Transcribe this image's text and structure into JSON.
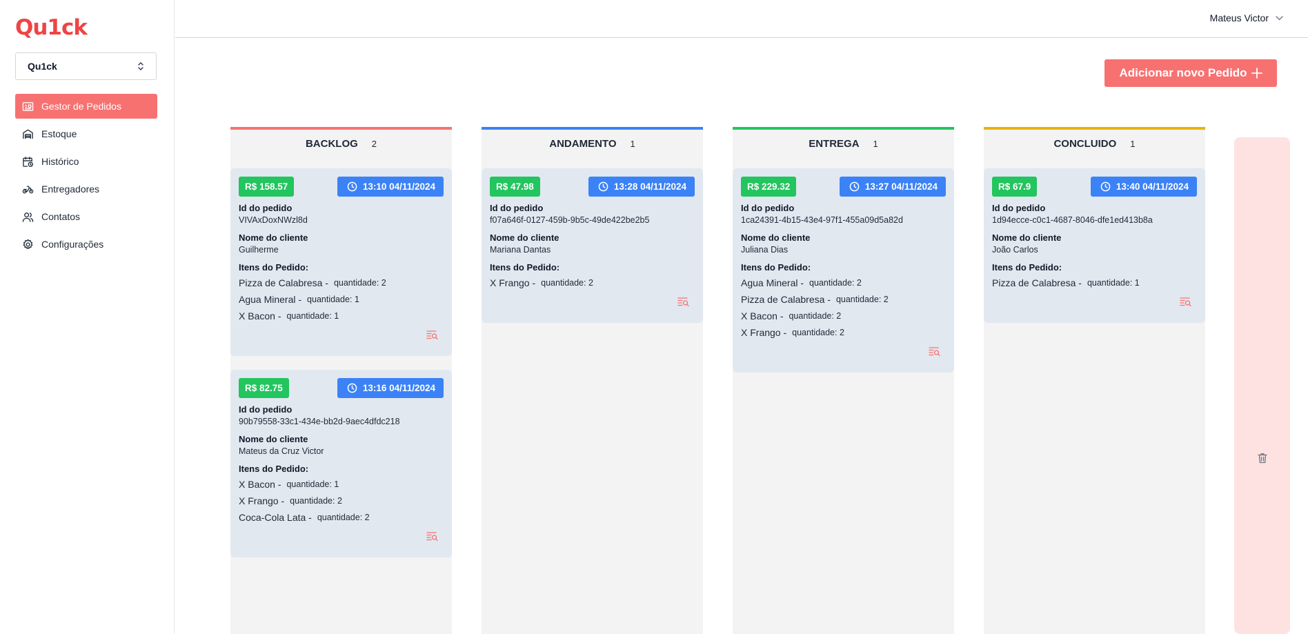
{
  "app": {
    "logo": "Qu1ck"
  },
  "selector": {
    "value": "Qu1ck"
  },
  "sidebar": {
    "items": [
      {
        "label": "Gestor de Pedidos",
        "icon": "orders-icon",
        "active": true
      },
      {
        "label": "Estoque",
        "icon": "warehouse-icon",
        "active": false
      },
      {
        "label": "Histórico",
        "icon": "calendar-history-icon",
        "active": false
      },
      {
        "label": "Entregadores",
        "icon": "motorbike-icon",
        "active": false
      },
      {
        "label": "Contatos",
        "icon": "users-icon",
        "active": false
      },
      {
        "label": "Configurações",
        "icon": "gear-icon",
        "active": false
      }
    ]
  },
  "header": {
    "user_name": "Mateus Victor"
  },
  "actions": {
    "add_order_label": "Adicionar novo Pedido"
  },
  "labels": {
    "order_id": "Id do pedido",
    "client_name": "Nome do cliente",
    "items": "Itens do Pedido:",
    "quantity_prefix": "quantidade:"
  },
  "colors": {
    "backlog": "#f87171",
    "andamento": "#3b82f6",
    "entrega": "#22c55e",
    "concluido": "#eab308",
    "price": "#22c55e",
    "time": "#3b82f6",
    "accent": "#f87171"
  },
  "board": {
    "columns": [
      {
        "title": "BACKLOG",
        "count": "2",
        "cards": [
          {
            "price": "R$ 158.57",
            "time": "13:10 04/11/2024",
            "order_id": "VIVAxDoxNWzl8d",
            "client": "Guilherme",
            "items": [
              {
                "name": "Pizza de Calabresa -",
                "qty": "quantidade: 2"
              },
              {
                "name": "Agua Mineral -",
                "qty": "quantidade: 1"
              },
              {
                "name": "X Bacon -",
                "qty": "quantidade: 1"
              }
            ]
          },
          {
            "price": "R$ 82.75",
            "time": "13:16 04/11/2024",
            "order_id": "90b79558-33c1-434e-bb2d-9aec4dfdc218",
            "client": "Mateus da Cruz Victor",
            "items": [
              {
                "name": "X Bacon -",
                "qty": "quantidade: 1"
              },
              {
                "name": "X Frango -",
                "qty": "quantidade: 2"
              },
              {
                "name": "Coca-Cola Lata -",
                "qty": "quantidade: 2"
              }
            ]
          }
        ]
      },
      {
        "title": "ANDAMENTO",
        "count": "1",
        "cards": [
          {
            "price": "R$ 47.98",
            "time": "13:28 04/11/2024",
            "order_id": "f07a646f-0127-459b-9b5c-49de422be2b5",
            "client": "Mariana Dantas",
            "items": [
              {
                "name": "X Frango -",
                "qty": "quantidade: 2"
              }
            ]
          }
        ]
      },
      {
        "title": "ENTREGA",
        "count": "1",
        "cards": [
          {
            "price": "R$ 229.32",
            "time": "13:27 04/11/2024",
            "order_id": "1ca24391-4b15-43e4-97f1-455a09d5a82d",
            "client": "Juliana Dias",
            "items": [
              {
                "name": "Agua Mineral -",
                "qty": "quantidade: 2"
              },
              {
                "name": "Pizza de Calabresa -",
                "qty": "quantidade: 2"
              },
              {
                "name": "X Bacon -",
                "qty": "quantidade: 2"
              },
              {
                "name": "X Frango -",
                "qty": "quantidade: 2"
              }
            ]
          }
        ]
      },
      {
        "title": "CONCLUIDO",
        "count": "1",
        "cards": [
          {
            "price": "R$ 67.9",
            "time": "13:40 04/11/2024",
            "order_id": "1d94ecce-c0c1-4687-8046-dfe1ed413b8a",
            "client": "João Carlos",
            "items": [
              {
                "name": "Pizza de Calabresa -",
                "qty": "quantidade: 1"
              }
            ]
          }
        ]
      }
    ]
  }
}
